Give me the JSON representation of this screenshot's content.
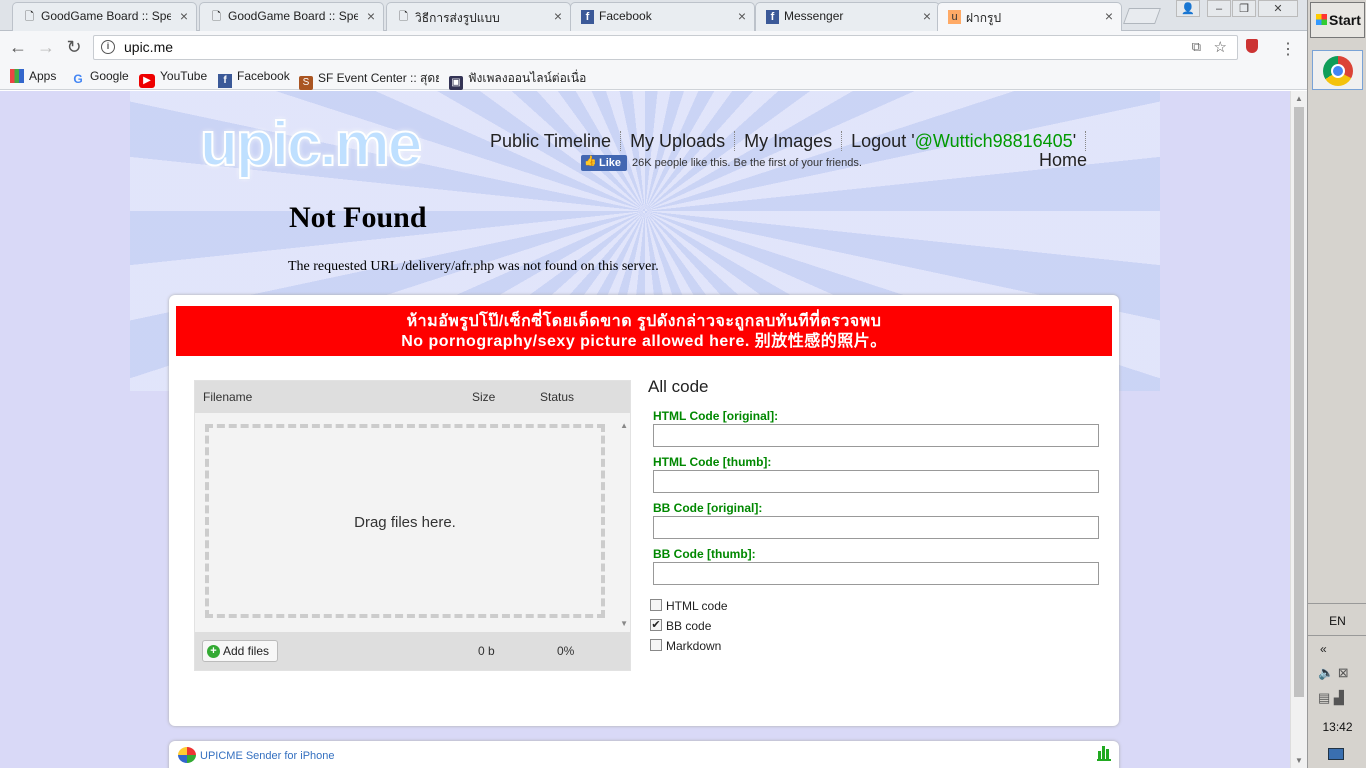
{
  "tabs": [
    {
      "label": "GoodGame Board :: Speci",
      "icon": "page-icon"
    },
    {
      "label": "GoodGame Board :: Speci",
      "icon": "page-icon"
    },
    {
      "label": "วิธีการส่งรูปแบบ",
      "icon": "page-icon"
    },
    {
      "label": "Facebook",
      "icon": "facebook-icon"
    },
    {
      "label": "Messenger",
      "icon": "facebook-icon"
    },
    {
      "label": "ฝากรูป",
      "icon": "upic-icon"
    }
  ],
  "address": {
    "url": "upic.me"
  },
  "bookmarks": [
    {
      "label": "Apps"
    },
    {
      "label": "Google"
    },
    {
      "label": "YouTube"
    },
    {
      "label": "Facebook"
    },
    {
      "label": "SF Event Center :: สุดย"
    },
    {
      "label": "ฟังเพลงออนไลน์ต่อเนื่อ"
    }
  ],
  "site": {
    "logo": "upic.me",
    "nav": {
      "public_timeline": "Public Timeline",
      "my_uploads": "My Uploads",
      "my_images": "My Images",
      "logout_prefix": "Logout '",
      "username": "@Wuttich98816405",
      "logout_suffix": "'",
      "home": "Home"
    },
    "fb_like": {
      "button": "Like",
      "text": "26K people like this. Be the first of your friends."
    }
  },
  "error": {
    "title": "Not Found",
    "message": "The requested URL /delivery/afr.php was not found on this server."
  },
  "warning": {
    "line1": "ห้ามอัพรูปโป๊/เซ็กซี่โดยเด็ดขาด รูปดังกล่าวจะถูกลบทันทีที่ตรวจพบ",
    "line2": "No pornography/sexy picture allowed here. 别放性感的照片。"
  },
  "uploader": {
    "headers": {
      "filename": "Filename",
      "size": "Size",
      "status": "Status"
    },
    "dropzone": "Drag files here.",
    "add_files": "Add files",
    "total_size": "0 b",
    "total_status": "0%"
  },
  "codes": {
    "title": "All code",
    "fields": [
      {
        "label": "HTML Code [original]:",
        "value": ""
      },
      {
        "label": "HTML Code [thumb]:",
        "value": ""
      },
      {
        "label": "BB Code [original]:",
        "value": ""
      },
      {
        "label": "BB Code [thumb]:",
        "value": ""
      }
    ],
    "options": [
      {
        "label": "HTML code",
        "checked": false
      },
      {
        "label": "BB code",
        "checked": true
      },
      {
        "label": "Markdown",
        "checked": false
      }
    ]
  },
  "sender": {
    "label": "UPICME Sender for iPhone"
  },
  "taskbar": {
    "start": "Start",
    "lang": "EN",
    "clock": "13:42",
    "collapse": "«"
  }
}
